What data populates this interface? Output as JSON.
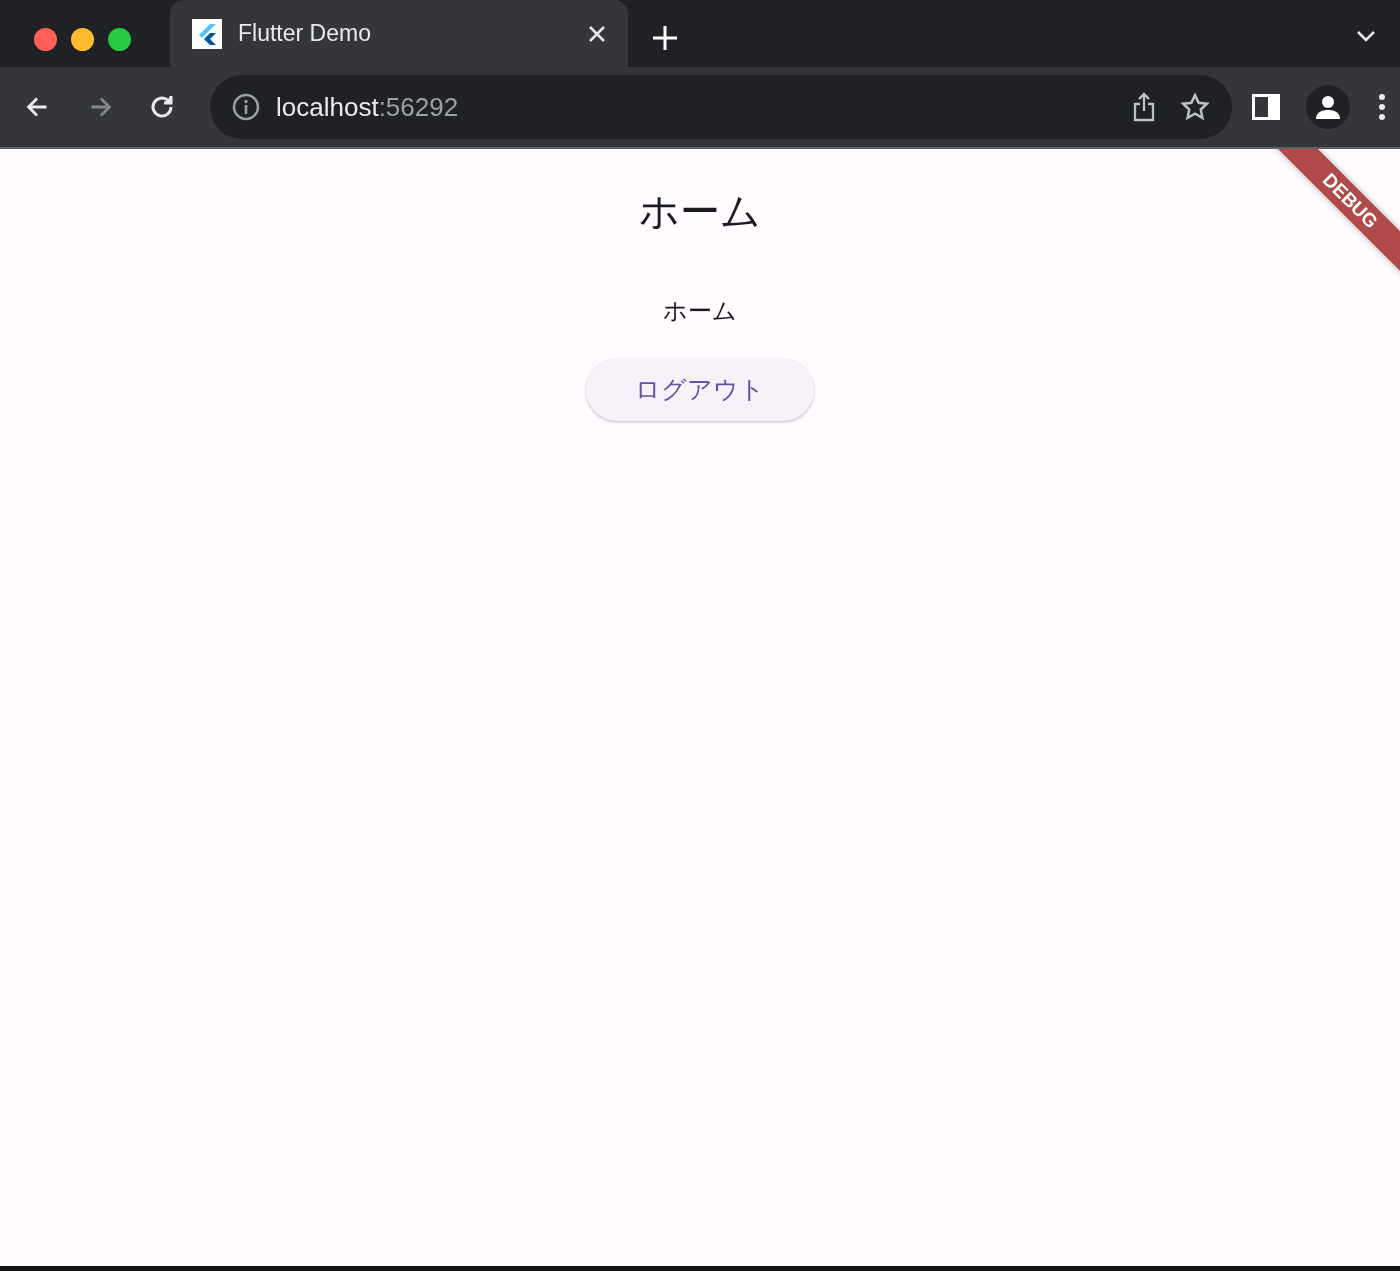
{
  "browser": {
    "tab": {
      "title": "Flutter Demo"
    },
    "nav": {
      "back": {
        "disabled": false
      },
      "forward": {
        "disabled": true
      }
    },
    "address": {
      "host": "localhost",
      "port": ":56292"
    }
  },
  "page": {
    "title": "ホーム",
    "text": "ホーム",
    "button": "ログアウト",
    "banner": "DEBUG"
  }
}
